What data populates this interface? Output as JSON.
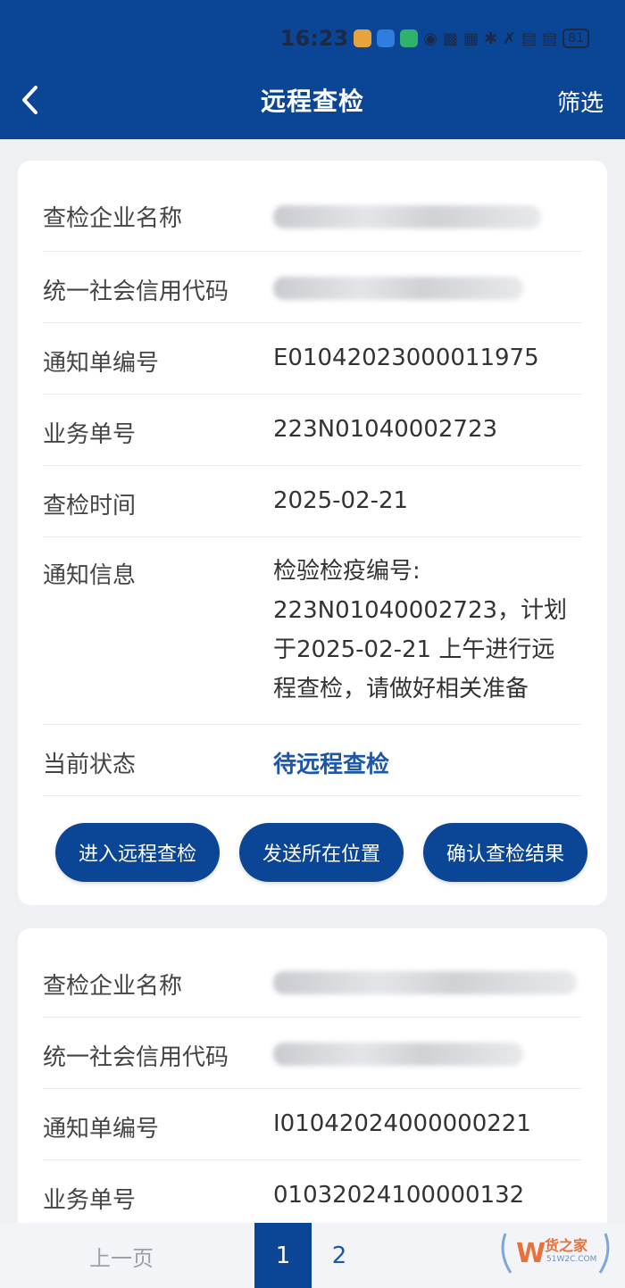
{
  "status_bar": {
    "time": "16:23",
    "battery": "81"
  },
  "header": {
    "title": "远程查检",
    "filter_label": "筛选"
  },
  "cards": [
    {
      "rows": [
        {
          "label": "查检企业名称",
          "value": ""
        },
        {
          "label": "统一社会信用代码",
          "value": ""
        },
        {
          "label": "通知单编号",
          "value": "E01042023000011975"
        },
        {
          "label": "业务单号",
          "value": "223N01040002723"
        },
        {
          "label": "查检时间",
          "value": "2025-02-21"
        },
        {
          "label": "通知信息",
          "value_lines": [
            "检验检疫编号:",
            "223N01040002723，计划",
            "于2025-02-21 上午进行远",
            "程查检，请做好相关准备"
          ]
        },
        {
          "label": "当前状态",
          "value": "待远程查检"
        }
      ],
      "buttons": [
        "进入远程查检",
        "发送所在位置",
        "确认查检结果"
      ]
    },
    {
      "rows": [
        {
          "label": "查检企业名称",
          "value": ""
        },
        {
          "label": "统一社会信用代码",
          "value": ""
        },
        {
          "label": "通知单编号",
          "value": "I01042024000000221"
        },
        {
          "label": "业务单号",
          "value": "01032024100000132"
        }
      ]
    }
  ],
  "pager": {
    "prev": "上一页",
    "pages": [
      "1",
      "2"
    ],
    "current": "1"
  },
  "watermark": {
    "brand": "货之家",
    "url": "51W2C.COM"
  },
  "colors": {
    "primary": "#0b4596",
    "status_text": "#1e57a8",
    "background": "#eef0f4"
  }
}
